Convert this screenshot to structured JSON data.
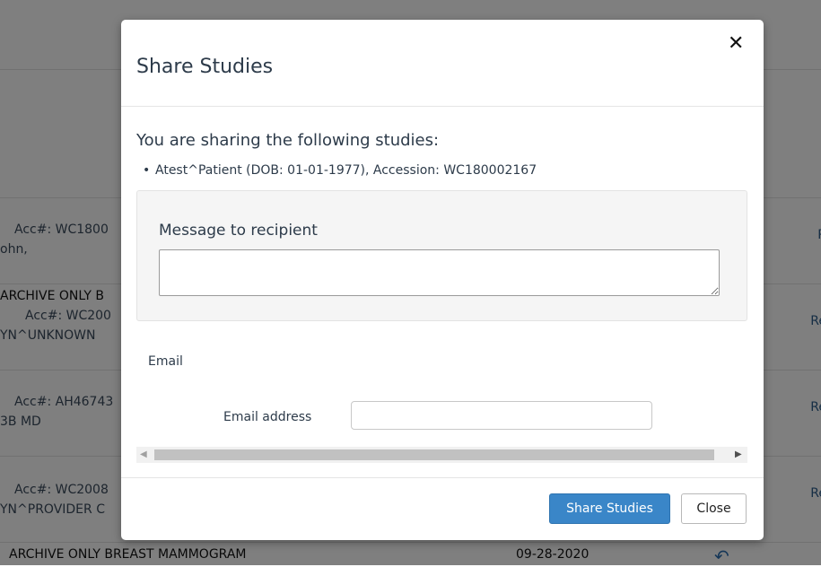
{
  "background": {
    "rows": [
      {
        "line1": "Acc#: WC1800",
        "line2": "ohn,",
        "action": "R"
      },
      {
        "line1": "ARCHIVE ONLY B",
        "line2": "Acc#: WC200",
        "line3": "YN^UNKNOWN",
        "action": "Re"
      },
      {
        "line1": "Acc#: AH46743",
        "line2": "3B MD",
        "action": "Re"
      },
      {
        "line1": "Acc#: WC2008",
        "line2": "YN^PROVIDER C",
        "action": "Re"
      }
    ],
    "bottom_row": {
      "procedure": "ARCHIVE ONLY BREAST MAMMOGRAM",
      "date": "09-28-2020",
      "share_icon": "share-arrow-icon"
    }
  },
  "modal": {
    "title": "Share Studies",
    "close_icon": "close-icon",
    "sharing_heading": "You are sharing the following studies:",
    "studies": [
      "Atest^Patient (DOB: 01-01-1977), Accession: WC180002167"
    ],
    "message_label": "Message to recipient",
    "message_value": "",
    "email_section_label": "Email",
    "email_address_label": "Email address",
    "email_address_value": "",
    "share_button_label": "Share Studies",
    "close_button_label": "Close"
  },
  "colors": {
    "overlay": "#000000",
    "primary_button": "#3a86c8"
  }
}
